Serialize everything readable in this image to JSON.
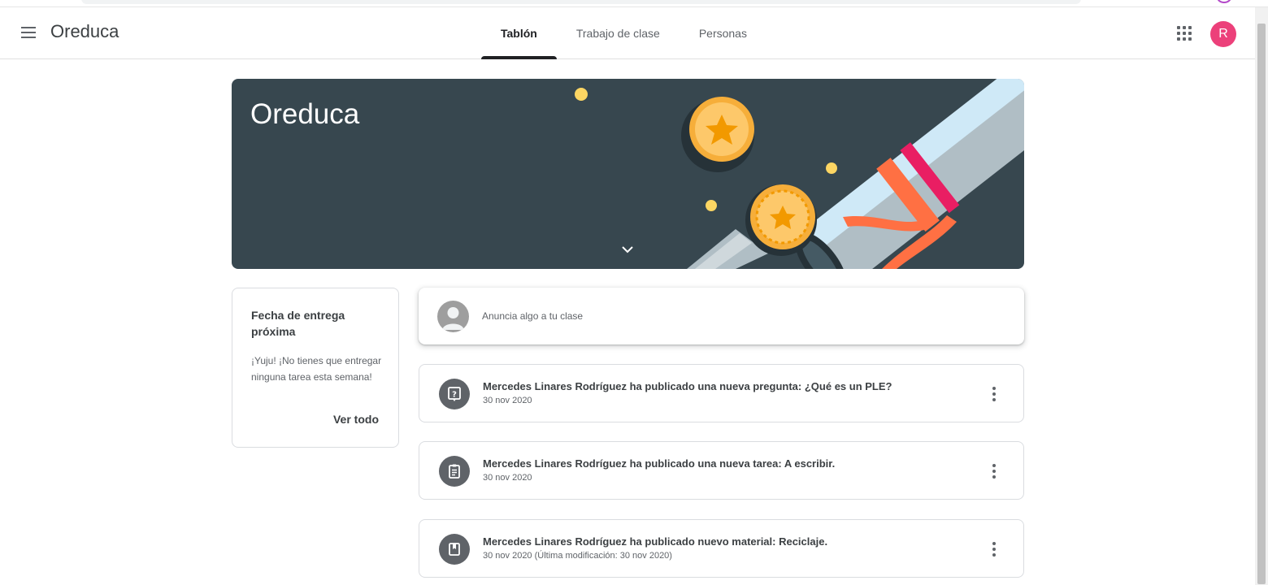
{
  "header": {
    "app_title": "Oreduca",
    "tabs": [
      {
        "label": "Tablón",
        "active": true
      },
      {
        "label": "Trabajo de clase",
        "active": false
      },
      {
        "label": "Personas",
        "active": false
      }
    ],
    "avatar_initial": "R",
    "avatar_color": "#ec407a"
  },
  "banner": {
    "class_name": "Oreduca",
    "background_color": "#37474f"
  },
  "upcoming": {
    "title": "Fecha de entrega próxima",
    "message": "¡Yuju! ¡No tienes que entregar ninguna tarea esta semana!",
    "view_all_label": "Ver todo"
  },
  "announce": {
    "placeholder": "Anuncia algo a tu clase"
  },
  "stream": [
    {
      "icon": "question-icon",
      "title": "Mercedes Linares Rodríguez ha publicado una nueva pregunta: ¿Qué es un PLE?",
      "date": "30 nov 2020"
    },
    {
      "icon": "assignment-icon",
      "title": "Mercedes Linares Rodríguez ha publicado una nueva tarea: A escribir.",
      "date": "30 nov 2020"
    },
    {
      "icon": "material-icon",
      "title": "Mercedes Linares Rodríguez ha publicado nuevo material: Reciclaje.",
      "date": "30 nov 2020 (Última modificación: 30 nov 2020)"
    }
  ]
}
